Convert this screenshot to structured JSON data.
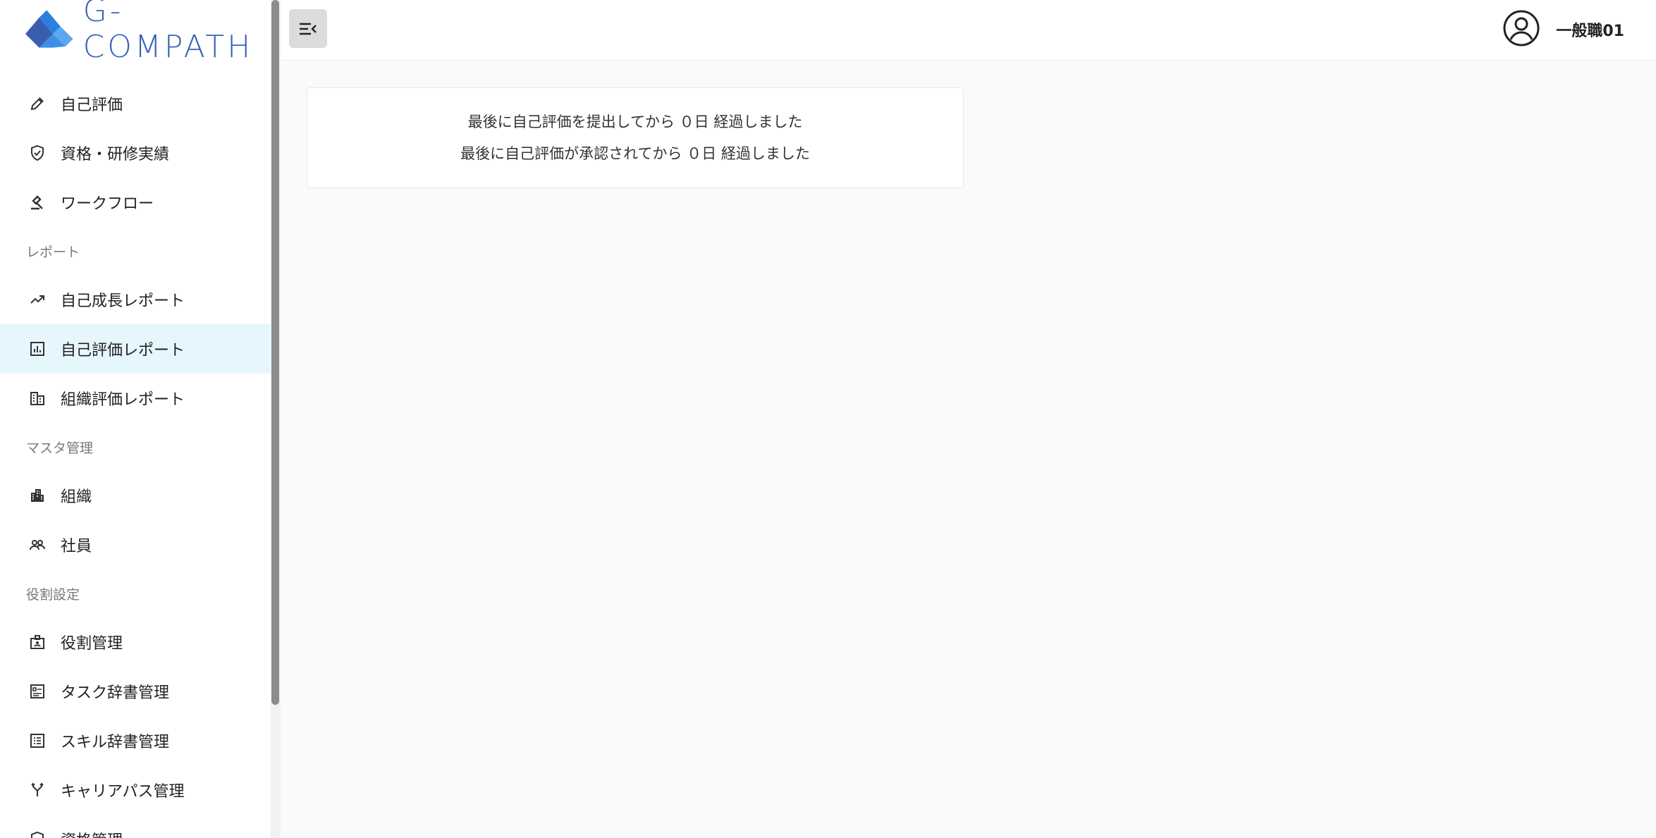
{
  "app": {
    "logo_text": "G-COMPATH"
  },
  "header": {
    "user_name": "一般職01"
  },
  "sidebar": {
    "items": [
      {
        "type": "item",
        "label": "自己評価",
        "icon": "pencil-icon"
      },
      {
        "type": "item",
        "label": "資格・研修実績",
        "icon": "shield-check-icon"
      },
      {
        "type": "item",
        "label": "ワークフロー",
        "icon": "gavel-icon"
      },
      {
        "type": "section",
        "label": "レポート"
      },
      {
        "type": "item",
        "label": "自己成長レポート",
        "icon": "trending-up-icon"
      },
      {
        "type": "item",
        "label": "自己評価レポート",
        "icon": "bar-chart-icon",
        "active": true
      },
      {
        "type": "item",
        "label": "組織評価レポート",
        "icon": "organization-icon"
      },
      {
        "type": "section",
        "label": "マスタ管理"
      },
      {
        "type": "item",
        "label": "組織",
        "icon": "buildings-icon"
      },
      {
        "type": "item",
        "label": "社員",
        "icon": "people-icon"
      },
      {
        "type": "section",
        "label": "役割設定"
      },
      {
        "type": "item",
        "label": "役割管理",
        "icon": "badge-icon"
      },
      {
        "type": "item",
        "label": "タスク辞書管理",
        "icon": "task-dictionary-icon"
      },
      {
        "type": "item",
        "label": "スキル辞書管理",
        "icon": "list-icon"
      },
      {
        "type": "item",
        "label": "キャリアパス管理",
        "icon": "fork-icon"
      },
      {
        "type": "item",
        "label": "資格管理",
        "icon": "shield-icon"
      }
    ]
  },
  "summary_card": {
    "line1": "最後に自己評価を提出してから ０日 経過しました",
    "line2": "最後に自己評価が承認されてから ０日 経過しました"
  },
  "colors": {
    "active_bg": "#e6f6fd",
    "logo_blue": "#3a63b8",
    "logo_light_blue": "#4a90e2"
  }
}
